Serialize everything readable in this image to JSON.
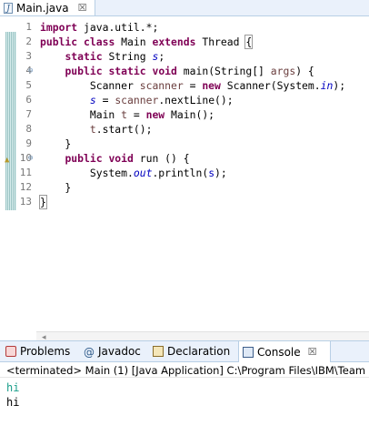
{
  "editor": {
    "tab_label": "Main.java",
    "close_glyph": "☒",
    "lines": [
      {
        "n": "1",
        "tokens": [
          {
            "t": "import",
            "c": "kw"
          },
          {
            "t": " java.util.*;",
            "c": ""
          }
        ]
      },
      {
        "n": "2",
        "tokens": [
          {
            "t": "public",
            "c": "kw"
          },
          {
            "t": " ",
            "c": ""
          },
          {
            "t": "class",
            "c": "kw"
          },
          {
            "t": " Main ",
            "c": ""
          },
          {
            "t": "extends",
            "c": "kw"
          },
          {
            "t": " Thread ",
            "c": ""
          },
          {
            "t": "{",
            "c": "cursor-box"
          }
        ]
      },
      {
        "n": "3",
        "tokens": [
          {
            "t": "    ",
            "c": ""
          },
          {
            "t": "static",
            "c": "kw"
          },
          {
            "t": " String ",
            "c": ""
          },
          {
            "t": "s",
            "c": "fld"
          },
          {
            "t": ";",
            "c": ""
          }
        ]
      },
      {
        "n": "4",
        "fold": "⊖",
        "tokens": [
          {
            "t": "    ",
            "c": ""
          },
          {
            "t": "public",
            "c": "kw"
          },
          {
            "t": " ",
            "c": ""
          },
          {
            "t": "static",
            "c": "kw"
          },
          {
            "t": " ",
            "c": ""
          },
          {
            "t": "void",
            "c": "kw"
          },
          {
            "t": " main(String[] ",
            "c": ""
          },
          {
            "t": "args",
            "c": "var"
          },
          {
            "t": ") {",
            "c": ""
          }
        ]
      },
      {
        "n": "5",
        "tokens": [
          {
            "t": "        Scanner ",
            "c": ""
          },
          {
            "t": "scanner",
            "c": "var"
          },
          {
            "t": " = ",
            "c": ""
          },
          {
            "t": "new",
            "c": "kw"
          },
          {
            "t": " Scanner(System.",
            "c": ""
          },
          {
            "t": "in",
            "c": "fld"
          },
          {
            "t": ");",
            "c": ""
          }
        ]
      },
      {
        "n": "6",
        "tokens": [
          {
            "t": "        ",
            "c": ""
          },
          {
            "t": "s",
            "c": "fld"
          },
          {
            "t": " = ",
            "c": ""
          },
          {
            "t": "scanner",
            "c": "var"
          },
          {
            "t": ".nextLine();",
            "c": ""
          }
        ]
      },
      {
        "n": "7",
        "tokens": [
          {
            "t": "        Main ",
            "c": ""
          },
          {
            "t": "t",
            "c": "var"
          },
          {
            "t": " = ",
            "c": ""
          },
          {
            "t": "new",
            "c": "kw"
          },
          {
            "t": " Main();",
            "c": ""
          }
        ]
      },
      {
        "n": "8",
        "tokens": [
          {
            "t": "        ",
            "c": ""
          },
          {
            "t": "t",
            "c": "var"
          },
          {
            "t": ".start();",
            "c": ""
          }
        ]
      },
      {
        "n": "9",
        "tokens": [
          {
            "t": "    }",
            "c": ""
          }
        ]
      },
      {
        "n": "10",
        "fold": "⊖",
        "warn": "▲",
        "tokens": [
          {
            "t": "    ",
            "c": ""
          },
          {
            "t": "public",
            "c": "kw"
          },
          {
            "t": " ",
            "c": ""
          },
          {
            "t": "void",
            "c": "kw"
          },
          {
            "t": " run () {",
            "c": ""
          }
        ]
      },
      {
        "n": "11",
        "tokens": [
          {
            "t": "        System.",
            "c": ""
          },
          {
            "t": "out",
            "c": "fld"
          },
          {
            "t": ".println(",
            "c": ""
          },
          {
            "t": "s",
            "c": "fld-u"
          },
          {
            "t": ");",
            "c": ""
          }
        ]
      },
      {
        "n": "12",
        "tokens": [
          {
            "t": "    }",
            "c": ""
          }
        ]
      },
      {
        "n": "13",
        "tokens": [
          {
            "t": "}",
            "c": "cursor-box"
          }
        ]
      }
    ],
    "scroll_arrow": "◂"
  },
  "panel": {
    "tabs": [
      {
        "label": "Problems",
        "icon": "problems-icon"
      },
      {
        "label": "Javadoc",
        "icon": "javadoc-icon",
        "glyph": "@"
      },
      {
        "label": "Declaration",
        "icon": "declaration-icon"
      },
      {
        "label": "Console",
        "icon": "console-icon",
        "active": true,
        "close": "☒"
      }
    ]
  },
  "console": {
    "status": "<terminated> Main (1) [Java Application] C:\\Program Files\\IBM\\Team",
    "output": [
      {
        "text": "hi",
        "kind": "stdout"
      },
      {
        "text": "hi",
        "kind": "stdin"
      }
    ]
  }
}
